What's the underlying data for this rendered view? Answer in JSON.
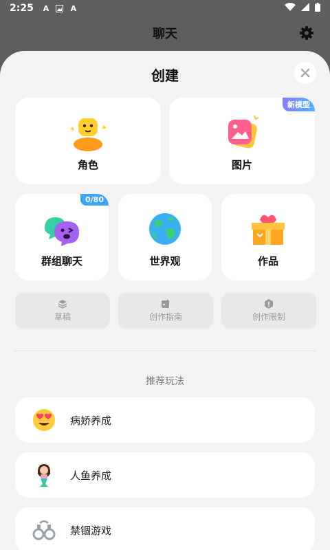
{
  "status_bar": {
    "time": "2:25",
    "icons": [
      "a-icon",
      "image-icon",
      "a-icon"
    ]
  },
  "header": {
    "title": "聊天"
  },
  "sheet": {
    "title": "创建",
    "cards": [
      {
        "label": "角色"
      },
      {
        "label": "图片",
        "badge": "新模型"
      },
      {
        "label": "群组聊天",
        "badge": "0/80"
      },
      {
        "label": "世界观"
      },
      {
        "label": "作品"
      }
    ],
    "tools": [
      {
        "label": "草稿",
        "icon": "layers-icon"
      },
      {
        "label": "创作指南",
        "icon": "guide-icon"
      },
      {
        "label": "创作限制",
        "icon": "warning-icon"
      }
    ],
    "section_title": "推荐玩法",
    "recommendations": [
      {
        "label": "病娇养成",
        "icon": "heart-eyes-emoji-icon"
      },
      {
        "label": "人鱼养成",
        "icon": "mermaid-icon"
      },
      {
        "label": "禁锢游戏",
        "icon": "handcuffs-icon"
      }
    ]
  },
  "colors": {
    "badge_gradient_start": "#8a7bff",
    "badge_gradient_end": "#4fb2ff",
    "count_badge": "#3aa6f5"
  }
}
